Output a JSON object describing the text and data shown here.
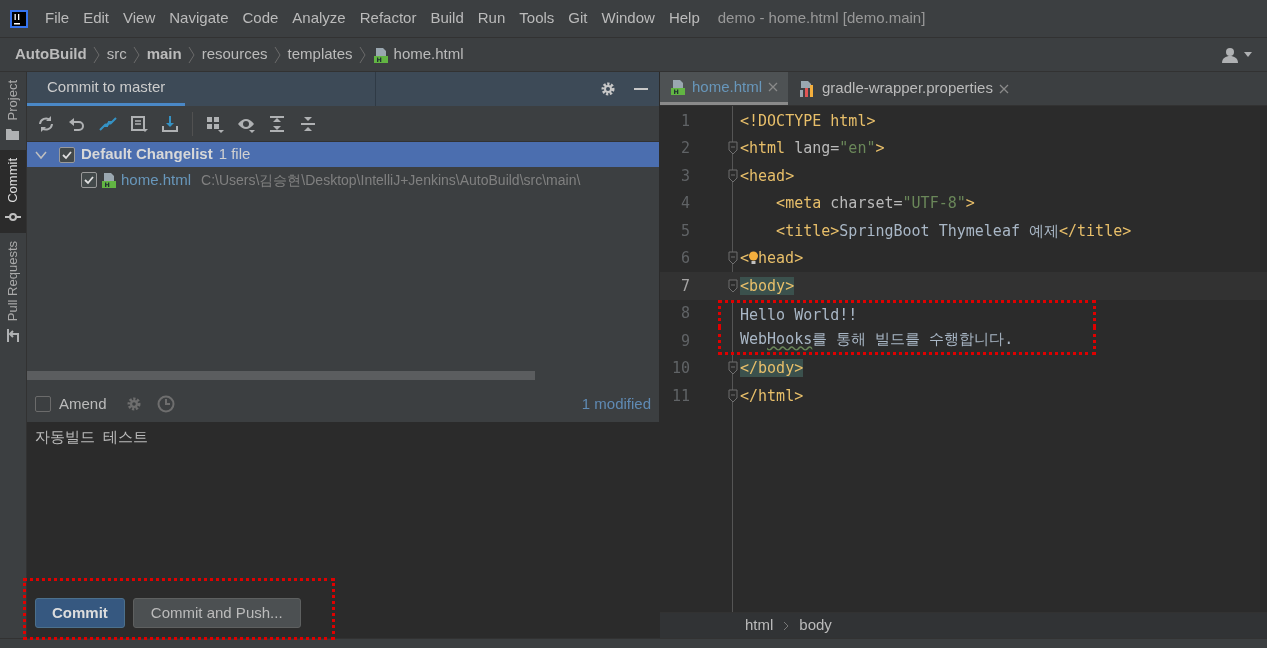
{
  "menu": [
    "File",
    "Edit",
    "View",
    "Navigate",
    "Code",
    "Analyze",
    "Refactor",
    "Build",
    "Run",
    "Tools",
    "Git",
    "Window",
    "Help"
  ],
  "window": {
    "title": "demo - home.html [demo.main]"
  },
  "breadcrumb": [
    {
      "label": "AutoBuild",
      "bold": true,
      "kind": "folder"
    },
    {
      "label": "src",
      "bold": false,
      "kind": "folder"
    },
    {
      "label": "main",
      "bold": true,
      "kind": "folder"
    },
    {
      "label": "resources",
      "bold": false,
      "kind": "folder"
    },
    {
      "label": "templates",
      "bold": false,
      "kind": "folder"
    },
    {
      "label": "home.html",
      "bold": false,
      "kind": "html"
    }
  ],
  "side_tabs": [
    {
      "label": "Project",
      "selected": false,
      "kind": "folder"
    },
    {
      "label": "Commit",
      "selected": true,
      "kind": "commit"
    },
    {
      "label": "Pull Requests",
      "selected": false,
      "kind": "pull"
    }
  ],
  "commit_panel": {
    "tab": "Commit to master",
    "changelist": {
      "name": "Default Changelist",
      "count": "1 file",
      "checked": true,
      "expanded": true,
      "selected": true,
      "files": [
        {
          "name": "home.html",
          "path": "C:\\Users\\김승현\\Desktop\\IntelliJ+Jenkins\\AutoBuild\\src\\main\\",
          "checked": true
        }
      ]
    },
    "amend": {
      "label": "Amend",
      "checked": false
    },
    "modified": "1 modified",
    "message": "자동빌드  테스트",
    "buttons": [
      {
        "label": "Commit",
        "kind": "primary"
      },
      {
        "label": "Commit and Push...",
        "kind": "secondary"
      }
    ],
    "annotated": true
  },
  "editor": {
    "tabs": [
      {
        "label": "home.html",
        "selected": true,
        "kind": "html"
      },
      {
        "label": "gradle-wrapper.properties",
        "selected": false,
        "kind": "properties"
      }
    ],
    "lines": [
      {
        "number": "1",
        "fold": false,
        "current": false,
        "annotated": false,
        "segments": [
          {
            "text": "<!DOCTYPE html>",
            "kind": "tag"
          }
        ]
      },
      {
        "number": "2",
        "fold": true,
        "current": false,
        "annotated": false,
        "segments": [
          {
            "text": "<html ",
            "kind": "tag"
          },
          {
            "text": "lang=",
            "kind": "attr"
          },
          {
            "text": "\"en\"",
            "kind": "value"
          },
          {
            "text": ">",
            "kind": "tag"
          }
        ]
      },
      {
        "number": "3",
        "fold": true,
        "current": false,
        "annotated": false,
        "segments": [
          {
            "text": "<head>",
            "kind": "tag"
          }
        ]
      },
      {
        "number": "4",
        "fold": false,
        "current": false,
        "annotated": false,
        "segments": [
          {
            "text": "    <meta ",
            "kind": "tag"
          },
          {
            "text": "charset=",
            "kind": "attr"
          },
          {
            "text": "\"UTF-8\"",
            "kind": "value"
          },
          {
            "text": ">",
            "kind": "tag"
          }
        ]
      },
      {
        "number": "5",
        "fold": false,
        "current": false,
        "annotated": false,
        "segments": [
          {
            "text": "    <title>",
            "kind": "tag"
          },
          {
            "text": "SpringBoot Thymeleaf 예제",
            "kind": "text"
          },
          {
            "text": "</title>",
            "kind": "tag"
          }
        ]
      },
      {
        "number": "6",
        "fold": true,
        "current": false,
        "annotated": false,
        "segments": [
          {
            "text": "<",
            "kind": "tag"
          },
          {
            "kind": "bulb"
          },
          {
            "text": "head>",
            "kind": "tag"
          }
        ]
      },
      {
        "number": "7",
        "fold": true,
        "current": true,
        "annotated": false,
        "segments": [
          {
            "text": "<body>",
            "kind": "matched"
          }
        ]
      },
      {
        "number": "8",
        "fold": false,
        "current": false,
        "annotated": true,
        "segments": [
          {
            "text": "Hello World!!",
            "kind": "text"
          }
        ]
      },
      {
        "number": "9",
        "fold": false,
        "current": false,
        "annotated": true,
        "segments": [
          {
            "text": "Web",
            "kind": "text"
          },
          {
            "text": "Hooks",
            "kind": "typo"
          },
          {
            "text": "를 통해 빌드를 수행합니다.",
            "kind": "text"
          }
        ]
      },
      {
        "number": "10",
        "fold": true,
        "current": false,
        "annotated": false,
        "segments": [
          {
            "text": "</body>",
            "kind": "matched"
          }
        ]
      },
      {
        "number": "11",
        "fold": true,
        "current": false,
        "annotated": false,
        "segments": [
          {
            "text": "</html>",
            "kind": "tag"
          }
        ]
      }
    ],
    "path": [
      "html",
      "body"
    ]
  }
}
